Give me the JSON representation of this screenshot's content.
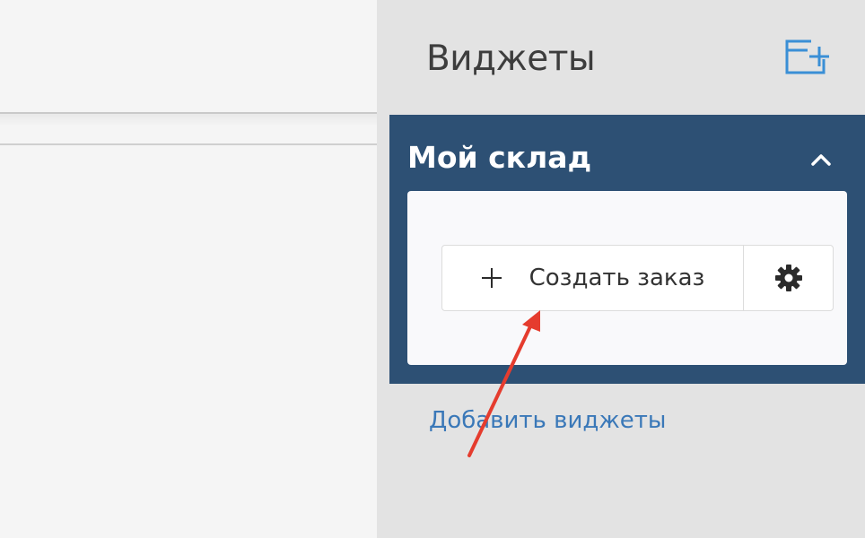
{
  "panel": {
    "title": "Виджеты",
    "add_widgets_link": "Добавить виджеты"
  },
  "widget": {
    "title": "Мой склад",
    "create_order_label": "Создать заказ"
  },
  "icons": {
    "add_widget": "add-widget-icon",
    "collapse": "chevron-up-icon",
    "plus": "plus-icon",
    "settings": "gear-icon",
    "annotation": "arrow-annotation"
  },
  "colors": {
    "panel_bg": "#e3e3e3",
    "widget_header": "#2d5074",
    "accent_blue": "#3a8fd6",
    "link": "#3a78b8",
    "annotation_red": "#e53c2e"
  }
}
